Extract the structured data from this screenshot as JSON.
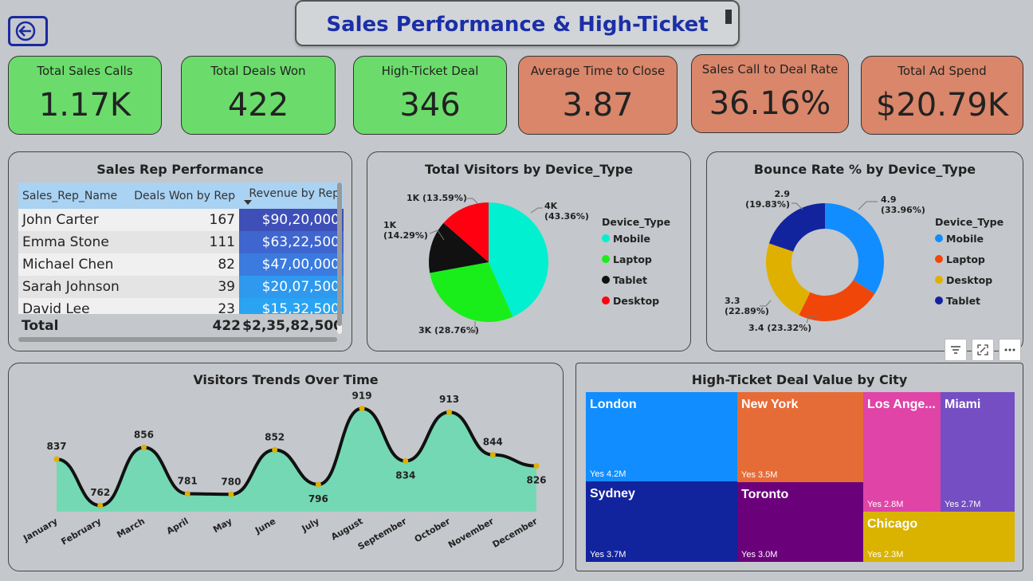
{
  "header": {
    "title": "Sales Performance & High-Ticket"
  },
  "kpis": [
    {
      "label": "Total Sales Calls",
      "value": "1.17K",
      "color": "#6bdc6b"
    },
    {
      "label": "Total Deals Won",
      "value": "422",
      "color": "#6bdc6b"
    },
    {
      "label": "High-Ticket Deal",
      "value": "346",
      "color": "#6bdc6b"
    },
    {
      "label": "Average Time to Close",
      "value": "3.87",
      "color": "#d9866a"
    },
    {
      "label": "Sales Call to Deal Rate",
      "value": "36.16%",
      "color": "#d9866a"
    },
    {
      "label": "Total Ad Spend",
      "value": "$20.79K",
      "color": "#d9866a"
    }
  ],
  "sales_rep_table": {
    "title": "Sales Rep Performance",
    "columns": [
      "Sales_Rep_Name",
      "Deals Won by Rep",
      "Revenue by Rep"
    ],
    "rows": [
      [
        "John Carter",
        "167",
        "$90,20,000"
      ],
      [
        "Emma Stone",
        "111",
        "$63,22,500"
      ],
      [
        "Michael Chen",
        "82",
        "$47,00,000"
      ],
      [
        "Sarah Johnson",
        "39",
        "$20,07,500"
      ],
      [
        "David Lee",
        "23",
        "$15,32,500"
      ]
    ],
    "total": [
      "Total",
      "422",
      "$2,35,82,500"
    ]
  },
  "chart_data": [
    {
      "type": "pie",
      "title": "Total Visitors by Device_Type",
      "legend_title": "Device_Type",
      "legend_placement": "right",
      "labels": [
        "Mobile",
        "Laptop",
        "Tablet",
        "Desktop"
      ],
      "values": [
        43.36,
        28.76,
        14.29,
        13.59
      ],
      "data_labels": [
        "4K (43.36%)",
        "3K (28.76%)",
        "1K (14.29%)",
        "1K (13.59%)"
      ],
      "colors": [
        "#00f0d0",
        "#1aee1a",
        "#111111",
        "#ff0010"
      ]
    },
    {
      "type": "pie",
      "title": "Bounce Rate % by Device_Type",
      "legend_title": "Device_Type",
      "legend_placement": "right",
      "labels": [
        "Mobile",
        "Laptop",
        "Desktop",
        "Tablet"
      ],
      "values": [
        4.9,
        3.4,
        3.3,
        2.9
      ],
      "percents": [
        33.96,
        23.32,
        22.89,
        19.83
      ],
      "data_labels": [
        "4.9 (33.96%)",
        "3.4 (23.32%)",
        "3.3 (22.89%)",
        "2.9 (19.83%)"
      ],
      "colors": [
        "#118dff",
        "#f0460a",
        "#e0b000",
        "#12239e"
      ]
    },
    {
      "type": "area",
      "title": "Visitors Trends Over Time",
      "x": [
        "January",
        "February",
        "March",
        "April",
        "May",
        "June",
        "July",
        "August",
        "September",
        "October",
        "November",
        "December"
      ],
      "values": [
        837,
        762,
        856,
        781,
        780,
        852,
        796,
        919,
        834,
        913,
        844,
        826
      ],
      "color": "#74d8b4"
    },
    {
      "type": "treemap",
      "title": "High-Ticket Deal Value by City",
      "labels": [
        "London",
        "Sydney",
        "New York",
        "Toronto",
        "Los Ange...",
        "Miami",
        "Chicago"
      ],
      "values": [
        4.2,
        3.7,
        3.5,
        3.0,
        2.8,
        2.7,
        2.3
      ],
      "value_labels": [
        "Yes 4.2M",
        "Yes 3.7M",
        "Yes 3.5M",
        "Yes 3.0M",
        "Yes 2.8M",
        "Yes 2.7M",
        "Yes 2.3M"
      ],
      "colors": [
        "#118dff",
        "#12239e",
        "#e66c37",
        "#6b007b",
        "#e044a7",
        "#744ec2",
        "#d9b300"
      ]
    }
  ]
}
